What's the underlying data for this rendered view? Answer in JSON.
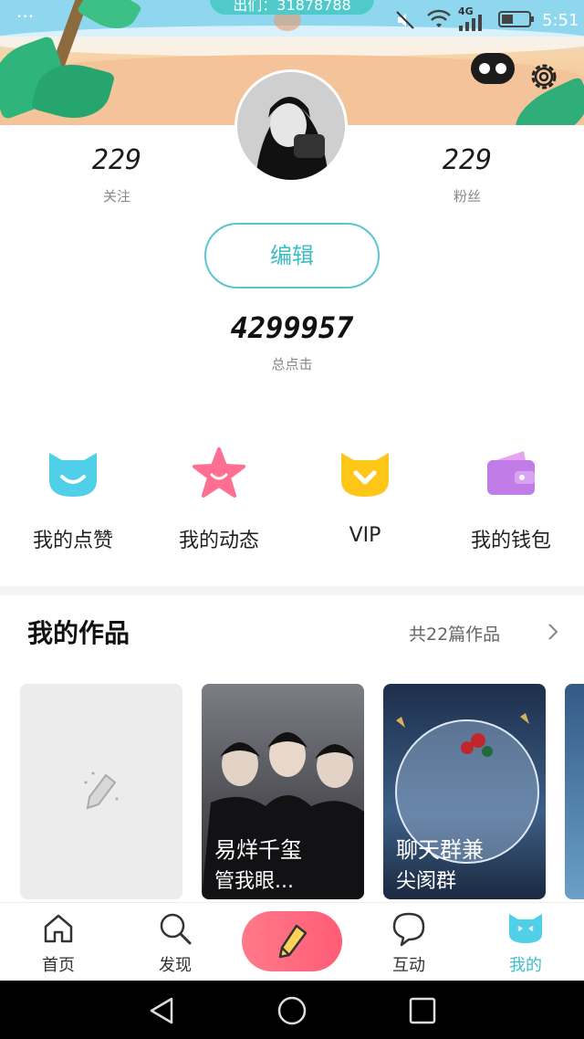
{
  "status_bar": {
    "dots": "···",
    "channel": "出们：31878788",
    "network": "4G",
    "time": "5:51"
  },
  "profile": {
    "following_count": "229",
    "following_label": "关注",
    "followers_count": "229",
    "followers_label": "粉丝",
    "edit_label": "编辑",
    "total_clicks": "4299957",
    "total_clicks_label": "总点击"
  },
  "quick_actions": [
    {
      "label": "我的点赞",
      "icon": "cat-smile-icon",
      "color": "#4fd0e8"
    },
    {
      "label": "我的动态",
      "icon": "star-icon",
      "color": "#ff6f91"
    },
    {
      "label": "VIP",
      "icon": "vip-cat-icon",
      "color": "#ffc61a"
    },
    {
      "label": "我的钱包",
      "icon": "wallet-icon",
      "color": "#c27ce8"
    }
  ],
  "works": {
    "title": "我的作品",
    "count_text": "共22篇作品",
    "items": [
      {
        "line1": "",
        "line2": ""
      },
      {
        "line1": "易烊千玺",
        "line2": "管我眼..."
      },
      {
        "line1": "聊天群兼",
        "line2": "尖阂群"
      }
    ]
  },
  "bottom_nav": [
    {
      "label": "首页",
      "icon": "home-icon"
    },
    {
      "label": "发现",
      "icon": "search-icon"
    },
    {
      "label": "",
      "icon": "pencil-icon"
    },
    {
      "label": "互动",
      "icon": "chat-bubble-icon"
    },
    {
      "label": "我的",
      "icon": "cat-face-icon"
    }
  ],
  "colors": {
    "accent": "#3bc0d0",
    "compose": "#ff6a7f"
  }
}
